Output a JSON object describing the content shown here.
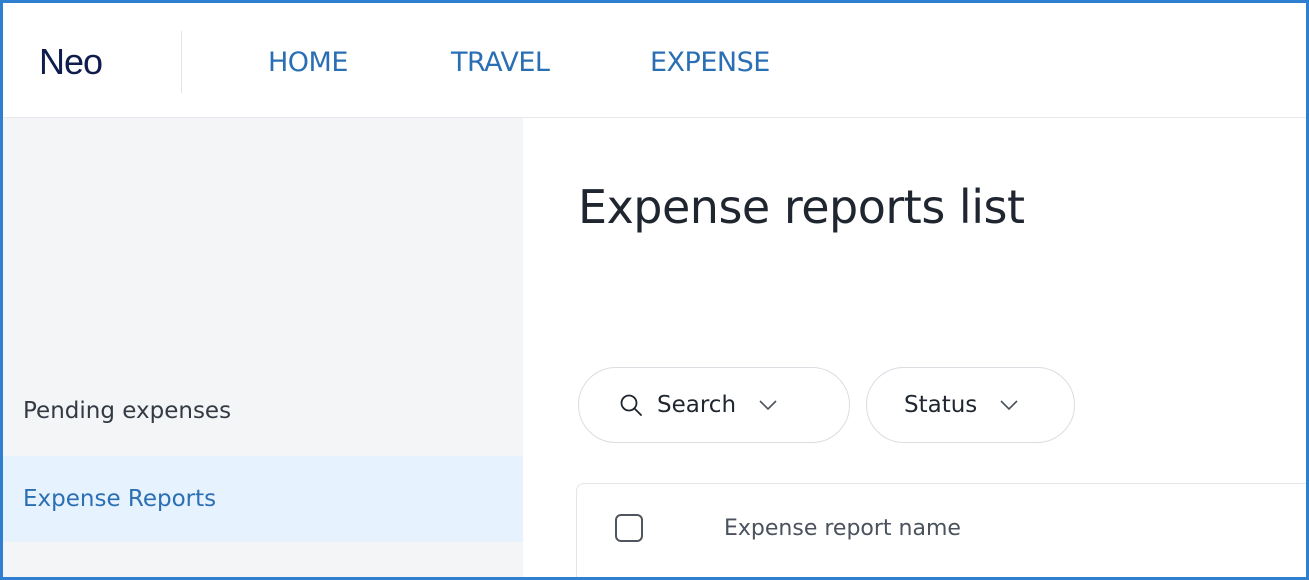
{
  "header": {
    "logo": "Neo",
    "nav": [
      {
        "label": "HOME"
      },
      {
        "label": "TRAVEL"
      },
      {
        "label": "EXPENSE"
      }
    ]
  },
  "sidebar": {
    "items": [
      {
        "label": "Pending expenses",
        "active": false
      },
      {
        "label": "Expense Reports",
        "active": true
      }
    ]
  },
  "main": {
    "title": "Expense reports list",
    "filters": {
      "search_label": "Search",
      "status_label": "Status"
    },
    "table": {
      "columns": [
        "Expense report name"
      ]
    }
  },
  "colors": {
    "accent": "#2a6fb4",
    "frame_border": "#2f7fd0",
    "active_bg": "#e6f2fd"
  },
  "icons": {
    "search": "search-icon",
    "chevron": "chevron-down-icon"
  }
}
